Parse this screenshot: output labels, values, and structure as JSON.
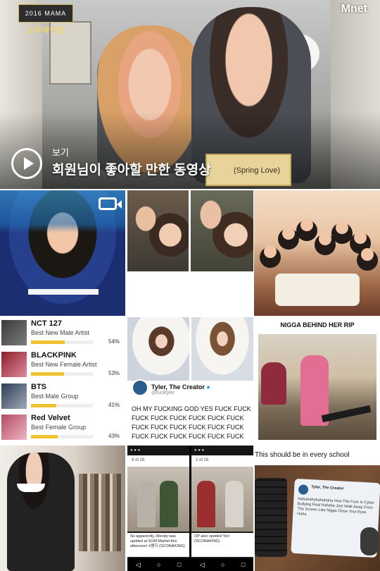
{
  "featured": {
    "show_badge": "노미네이션",
    "show_badge_year": "2016 MAMA",
    "channel": "Mnet",
    "caption_song": "(Spring Love)",
    "play_label": "보기",
    "title": "회원님이 좋아할 만한 동영상",
    "icon": "play-circle-icon"
  },
  "poll": {
    "bar_color": "#f1c232",
    "entries": [
      {
        "name": "NCT 127",
        "category": "Best New Male Artist",
        "percent": "54%",
        "share": 0.54
      },
      {
        "name": "BLACKPINK",
        "category": "Best New Female Artist",
        "percent": "53%",
        "share": 0.53
      },
      {
        "name": "BTS",
        "category": "Best Male Group",
        "percent": "41%",
        "share": 0.41
      },
      {
        "name": "Red Velvet",
        "category": "Best Female Group",
        "percent": "43%",
        "share": 0.43
      }
    ]
  },
  "tweet": {
    "author": "Tyler, The Creator",
    "handle": "@fucktyler",
    "verified_icon": "verified-badge-icon",
    "text": "OH MY FUCKING GOD YES FUCK FUCK FUCK FUCK FUCK FUCK FUCK FUCK FUCK FUCK FUCK FUCK FUCK FUCK FUCK FUCK FUCK FUCK FUCK FUCK"
  },
  "meme": {
    "header": "NIGGA BEHIND HER RIP"
  },
  "phones": {
    "left_pager": "9 of 28",
    "right_pager": "2 of 28",
    "left_caption": "So apparently, Wendy was spotted at SUM Market this afternoon! #웬디 (SCONAKING)",
    "right_caption": "OP also spotted Yeri (SCONAKING)"
  },
  "school": {
    "title": "This should be in every school",
    "note_author": "Tyler, The Creator",
    "note_text": "Hahahahahahahaha How The Fuck Is Cyber Bullying Real Hahaha Just Walk Away From The Screen Like Nigga Close Your Eyes Haha"
  },
  "icons": {
    "video": "video-camera-icon"
  }
}
